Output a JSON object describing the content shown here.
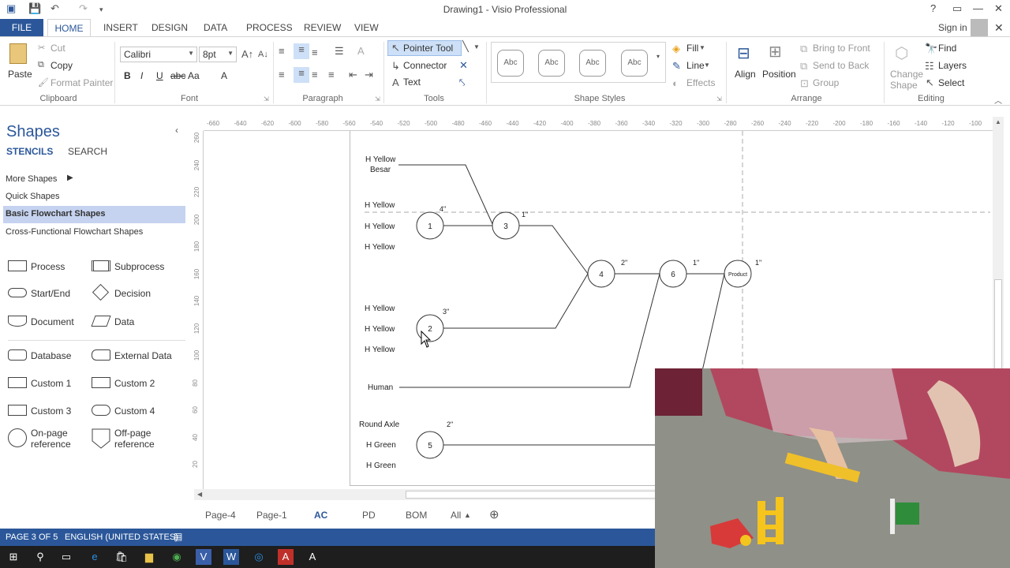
{
  "app": {
    "title": "Drawing1 - Visio Professional",
    "sign_in": "Sign in"
  },
  "tabs": [
    "FILE",
    "HOME",
    "INSERT",
    "DESIGN",
    "DATA",
    "PROCESS",
    "REVIEW",
    "VIEW"
  ],
  "ribbon": {
    "clipboard": {
      "paste": "Paste",
      "cut": "Cut",
      "copy": "Copy",
      "format_painter": "Format Painter",
      "label": "Clipboard"
    },
    "font": {
      "name": "Calibri",
      "size": "8pt",
      "label": "Font",
      "bold": "B",
      "italic": "I",
      "underline": "U",
      "strike": "abc",
      "case": "Aa",
      "color": "A"
    },
    "paragraph": {
      "label": "Paragraph"
    },
    "tools": {
      "pointer": "Pointer Tool",
      "connector": "Connector",
      "text": "Text",
      "label": "Tools"
    },
    "shape_styles": {
      "sample": "Abc",
      "label": "Shape Styles",
      "fill": "Fill",
      "line": "Line",
      "effects": "Effects"
    },
    "arrange": {
      "align": "Align",
      "position": "Position",
      "bring_front": "Bring to Front",
      "send_back": "Send to Back",
      "group": "Group",
      "label": "Arrange"
    },
    "editing": {
      "change_shape": "Change",
      "change_shape2": "Shape",
      "find": "Find",
      "layers": "Layers",
      "select": "Select",
      "label": "Editing"
    }
  },
  "shapes_pane": {
    "title": "Shapes",
    "stencils": "STENCILS",
    "search": "SEARCH",
    "more_shapes": "More Shapes",
    "quick_shapes": "Quick Shapes",
    "basic_flowchart": "Basic Flowchart Shapes",
    "cross_functional": "Cross-Functional Flowchart Shapes",
    "items": [
      {
        "left": "Process",
        "right": "Subprocess"
      },
      {
        "left": "Start/End",
        "right": "Decision"
      },
      {
        "left": "Document",
        "right": "Data"
      },
      {
        "left": "Database",
        "right": "External Data"
      },
      {
        "left": "Custom 1",
        "right": "Custom 2"
      },
      {
        "left": "Custom 3",
        "right": "Custom 4"
      },
      {
        "left": "On-page",
        "left2": "reference",
        "right": "Off-page",
        "right2": "reference"
      }
    ]
  },
  "rulers": {
    "h": [
      "-660",
      "-640",
      "-620",
      "-600",
      "-580",
      "-560",
      "-540",
      "-520",
      "-500",
      "-480",
      "-460",
      "-440",
      "-420",
      "-400",
      "-380",
      "-360",
      "-340",
      "-320",
      "-300",
      "-280",
      "-260",
      "-240",
      "-220",
      "-200",
      "-180",
      "-160",
      "-140",
      "-120",
      "-100"
    ],
    "v": [
      "260",
      "240",
      "220",
      "200",
      "180",
      "160",
      "140",
      "120",
      "100",
      "80",
      "60",
      "40",
      "20"
    ]
  },
  "diagram": {
    "labels": {
      "hy_besar1": "H Yellow",
      "hy_besar2": "Besar",
      "hy_a": "H Yellow",
      "hy_b": "H Yellow",
      "hy_c": "H Yellow",
      "hy_d": "H Yellow",
      "hy_e": "H Yellow",
      "hy_f": "H Yellow",
      "human": "Human",
      "round_axle": "Round Axle",
      "hg_a": "H Green",
      "hg_b": "H Green"
    },
    "nodes": {
      "n1": "1",
      "n2": "2",
      "n3": "3",
      "n4": "4",
      "n5": "5",
      "n6": "6",
      "product": "Product"
    },
    "times": {
      "t1": "4\"",
      "t2": "3\"",
      "t3": "1\"",
      "t4": "2\"",
      "t5": "2\"",
      "t6": "1\"",
      "tp": "1\""
    }
  },
  "page_tabs": [
    "Page-4",
    "Page-1",
    "AC",
    "PD",
    "BOM",
    "All"
  ],
  "status": {
    "page": "PAGE 3 OF 5",
    "lang": "ENGLISH (UNITED STATES)"
  },
  "colors": {
    "accent": "#2b579a",
    "tab_active": "#2b579a",
    "selected_stencil": "#c5d3f0"
  }
}
